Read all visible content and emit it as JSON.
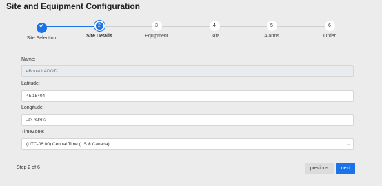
{
  "page_title": "Site and Equipment Configuration",
  "stepper": {
    "steps": [
      {
        "number": "",
        "label": "Site Selection",
        "state": "done"
      },
      {
        "number": "2",
        "label": "Site Details",
        "state": "active"
      },
      {
        "number": "3",
        "label": "Equipment",
        "state": "pending"
      },
      {
        "number": "4",
        "label": "Data",
        "state": "pending"
      },
      {
        "number": "5",
        "label": "Alarms",
        "state": "pending"
      },
      {
        "number": "6",
        "label": "Order",
        "state": "pending"
      }
    ]
  },
  "form": {
    "name_label": "Name:",
    "name_value": "eBoost LADOT-1",
    "latitude_label": "Latitude:",
    "latitude_value": "45.15404",
    "longitude_label": "Longitude:",
    "longitude_value": "-93.39302",
    "timezone_label": "TimeZone:",
    "timezone_value": "(UTC-06:00) Central Time (US & Canada)"
  },
  "footer": {
    "step_count": "Step 2 of 6",
    "previous_label": "previous",
    "next_label": "next"
  },
  "colors": {
    "accent": "#1a73e8",
    "background": "#ececec"
  }
}
